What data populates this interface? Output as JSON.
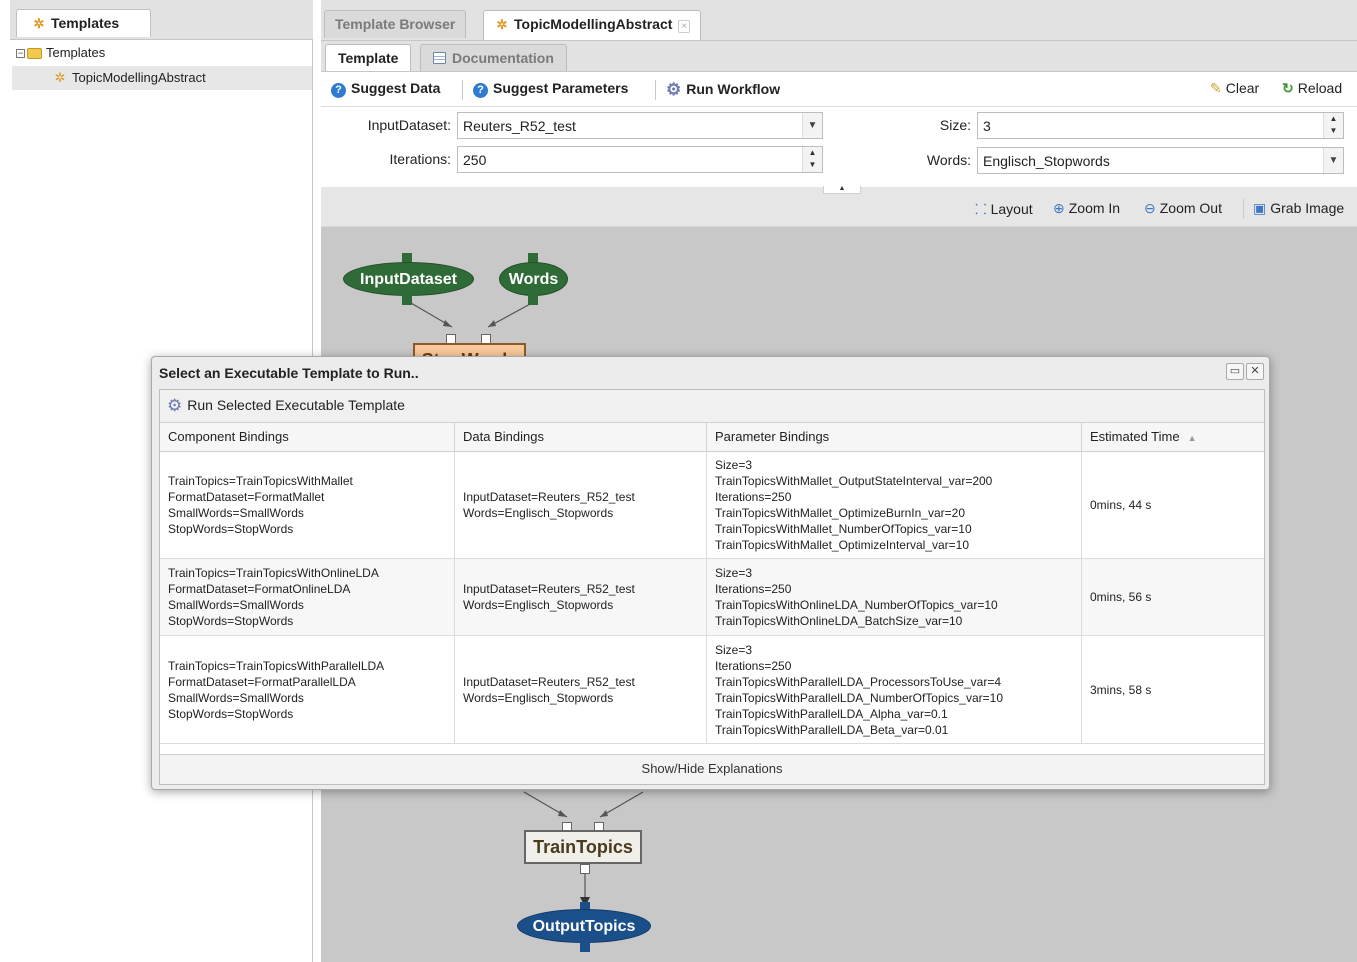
{
  "left": {
    "tab_label": "Templates",
    "tree_root": "Templates",
    "tree_child": "TopicModellingAbstract"
  },
  "tabs": {
    "browser": "Template Browser",
    "current": "TopicModellingAbstract"
  },
  "subtabs": {
    "template": "Template",
    "documentation": "Documentation"
  },
  "toolbar": {
    "suggest_data": "Suggest Data",
    "suggest_parameters": "Suggest Parameters",
    "run_workflow": "Run Workflow",
    "clear": "Clear",
    "reload": "Reload"
  },
  "form": {
    "input_dataset_label": "InputDataset:",
    "input_dataset_value": "Reuters_R52_test",
    "iterations_label": "Iterations:",
    "iterations_value": "250",
    "size_label": "Size:",
    "size_value": "3",
    "words_label": "Words:",
    "words_value": "Englisch_Stopwords"
  },
  "canvas": {
    "layout": "Layout",
    "zoom_in": "Zoom In",
    "zoom_out": "Zoom Out",
    "grab_image": "Grab Image",
    "nodes": {
      "input_dataset": "InputDataset",
      "words": "Words",
      "stopwords": "StopWords",
      "train_topics": "TrainTopics",
      "output_topics": "OutputTopics"
    }
  },
  "dialog": {
    "title": "Select an Executable Template to Run..",
    "run_button": "Run Selected Executable Template",
    "columns": [
      "Component Bindings",
      "Data Bindings",
      "Parameter Bindings",
      "Estimated Time"
    ],
    "rows": [
      {
        "components": [
          "TrainTopics=TrainTopicsWithMallet",
          "FormatDataset=FormatMallet",
          "SmallWords=SmallWords",
          "StopWords=StopWords"
        ],
        "data": [
          "InputDataset=Reuters_R52_test",
          "Words=Englisch_Stopwords"
        ],
        "parameters": [
          "Size=3",
          "TrainTopicsWithMallet_OutputStateInterval_var=200",
          "Iterations=250",
          "TrainTopicsWithMallet_OptimizeBurnIn_var=20",
          "TrainTopicsWithMallet_NumberOfTopics_var=10",
          "TrainTopicsWithMallet_OptimizeInterval_var=10"
        ],
        "time": "0mins, 44 s"
      },
      {
        "components": [
          "TrainTopics=TrainTopicsWithOnlineLDA",
          "FormatDataset=FormatOnlineLDA",
          "SmallWords=SmallWords",
          "StopWords=StopWords"
        ],
        "data": [
          "InputDataset=Reuters_R52_test",
          "Words=Englisch_Stopwords"
        ],
        "parameters": [
          "Size=3",
          "Iterations=250",
          "TrainTopicsWithOnlineLDA_NumberOfTopics_var=10",
          "TrainTopicsWithOnlineLDA_BatchSize_var=10"
        ],
        "time": "0mins, 56 s"
      },
      {
        "components": [
          "TrainTopics=TrainTopicsWithParallelLDA",
          "FormatDataset=FormatParallelLDA",
          "SmallWords=SmallWords",
          "StopWords=StopWords"
        ],
        "data": [
          "InputDataset=Reuters_R52_test",
          "Words=Englisch_Stopwords"
        ],
        "parameters": [
          "Size=3",
          "Iterations=250",
          "TrainTopicsWithParallelLDA_ProcessorsToUse_var=4",
          "TrainTopicsWithParallelLDA_NumberOfTopics_var=10",
          "TrainTopicsWithParallelLDA_Alpha_var=0.1",
          "TrainTopicsWithParallelLDA_Beta_var=0.01"
        ],
        "time": "3mins, 58 s"
      }
    ],
    "show_hide": "Show/Hide Explanations"
  }
}
